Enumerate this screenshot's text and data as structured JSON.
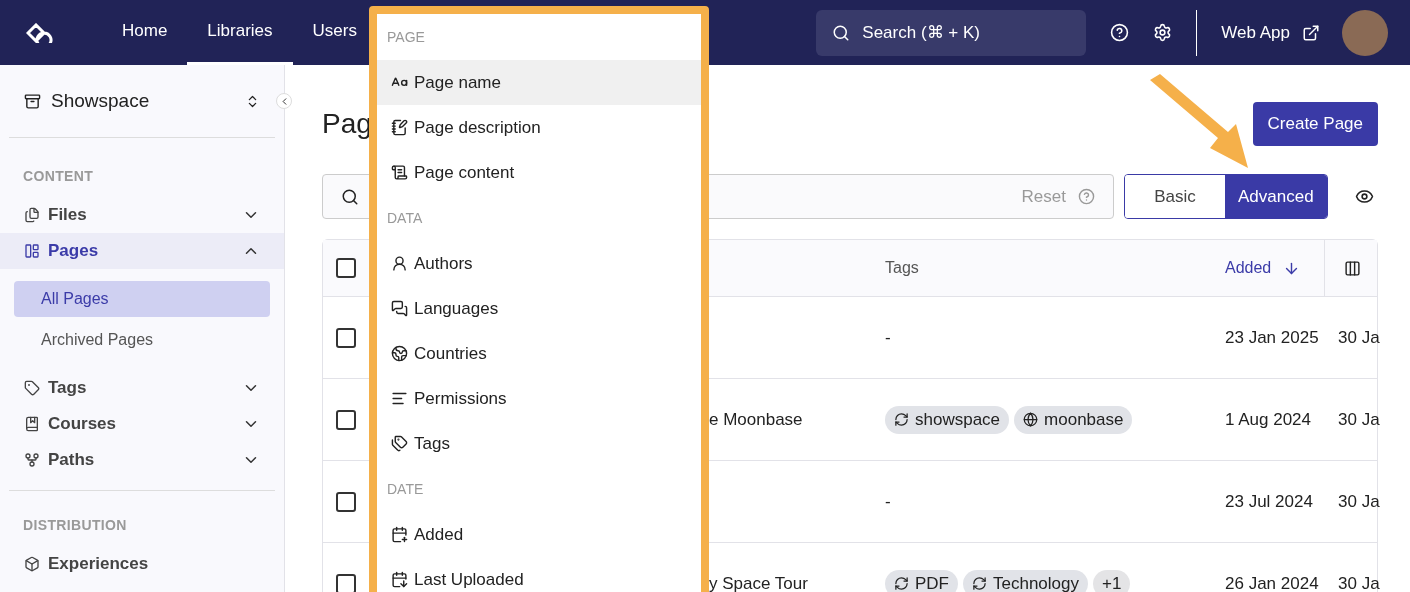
{
  "nav": {
    "items": [
      {
        "label": "Home",
        "selected": false
      },
      {
        "label": "Libraries",
        "selected": true
      },
      {
        "label": "Users",
        "selected": false
      }
    ],
    "search": {
      "placeholder": "Search (⌘ + K)"
    },
    "web_app": "Web App"
  },
  "sidebar": {
    "workspace": "Showspace",
    "sections": [
      {
        "heading": "CONTENT",
        "items": [
          {
            "label": "Files",
            "expanded": false,
            "selected": false
          },
          {
            "label": "Pages",
            "expanded": true,
            "selected": true,
            "children": [
              {
                "label": "All Pages",
                "selected": true
              },
              {
                "label": "Archived Pages",
                "selected": false
              }
            ]
          },
          {
            "label": "Tags",
            "expanded": false,
            "selected": false
          },
          {
            "label": "Courses",
            "expanded": false,
            "selected": false
          },
          {
            "label": "Paths",
            "expanded": false,
            "selected": false
          }
        ]
      },
      {
        "heading": "DISTRIBUTION",
        "items": [
          {
            "label": "Experiences",
            "selected": false
          }
        ]
      }
    ]
  },
  "main": {
    "title": "Pag",
    "create_button": "Create Page",
    "filter": {
      "reset": "Reset"
    },
    "view_toggle": [
      {
        "label": "Basic",
        "selected": false
      },
      {
        "label": "Advanced",
        "selected": true
      }
    ],
    "table": {
      "select_all_checked": false,
      "columns": [
        {
          "label": "Tags",
          "sorted": false
        },
        {
          "label": "Added",
          "sorted": true
        }
      ],
      "rows": [
        {
          "checked": false,
          "tags_text": "-",
          "added": "23 Jan 2025",
          "column_5": "30 Ja"
        },
        {
          "checked": false,
          "title": "e Moonbase",
          "tags": [
            {
              "label": "showspace",
              "kind": "synced"
            },
            {
              "label": "moonbase",
              "kind": "globe"
            }
          ],
          "added": "1 Aug 2024",
          "column_5": "30 Ja"
        },
        {
          "checked": false,
          "tags_text": "-",
          "added": "23 Jul 2024",
          "column_5": "30 Ja"
        },
        {
          "checked": false,
          "title": "y Space Tour",
          "tags": [
            {
              "label": "PDF",
              "kind": "synced"
            },
            {
              "label": "Technology",
              "kind": "synced"
            },
            {
              "label": "+1",
              "kind": "count"
            }
          ],
          "added": "26 Jan 2024",
          "column_5": "30 Ja"
        }
      ]
    }
  },
  "dropdown": {
    "sections": [
      {
        "heading": "PAGE",
        "items": [
          {
            "label": "Page name",
            "selected": true
          },
          {
            "label": "Page description",
            "selected": false
          },
          {
            "label": "Page content",
            "selected": false
          }
        ]
      },
      {
        "heading": "DATA",
        "items": [
          {
            "label": "Authors",
            "selected": false
          },
          {
            "label": "Languages",
            "selected": false
          },
          {
            "label": "Countries",
            "selected": false
          },
          {
            "label": "Permissions",
            "selected": false
          },
          {
            "label": "Tags",
            "selected": false
          }
        ]
      },
      {
        "heading": "DATE",
        "items": [
          {
            "label": "Added",
            "selected": false
          },
          {
            "label": "Last Uploaded",
            "selected": false
          }
        ]
      }
    ]
  }
}
